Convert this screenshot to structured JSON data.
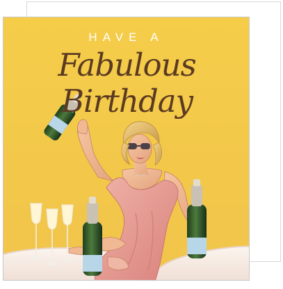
{
  "card": {
    "headline": "HAVE A",
    "script": "Fabulous Birthday"
  },
  "colors": {
    "background": "#f3c949",
    "text_script": "#5b3a22",
    "dress": "#e49b93",
    "table": "#f7efe8",
    "bottle": "#2f5b2d"
  }
}
